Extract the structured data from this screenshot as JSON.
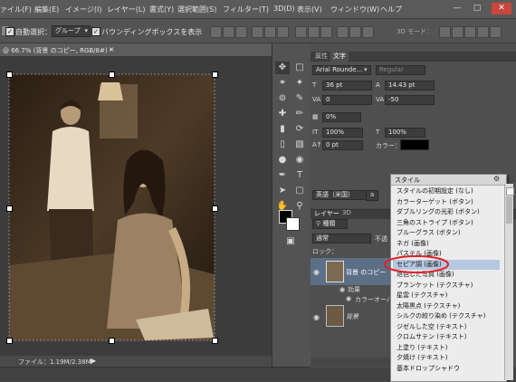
{
  "menu": [
    "ァイル(F)",
    "編集(E)",
    "イメージ(I)",
    "レイヤー(L)",
    "書式(Y)",
    "選択範囲(S)",
    "フィルター(T)",
    "3D(D)",
    "表示(V)",
    "ウィンドウ(W)",
    "ヘルプ"
  ],
  "options": {
    "auto_select_label": "自動選択：",
    "auto_select_value": "グループ",
    "bbox_label": "バウンディングボックスを表示",
    "mode_3d": "3D モード："
  },
  "document": {
    "tab_label": "@ 66.7% (背景 のコピー, RGB/8#) *",
    "file_status": "ファイル：1.19M/2.38M"
  },
  "character": {
    "tabs": [
      "属性",
      "文字"
    ],
    "font_family": "Arial Rounde...",
    "font_style": "Regular",
    "size": "36 pt",
    "leading": "14.43 pt",
    "kerning": "0",
    "tracking": "-50",
    "scale_pct": "0%",
    "vscale": "100%",
    "hscale": "100%",
    "baseline": "0 pt",
    "color_label": "カラー：",
    "language": "英語（米国）",
    "aa_badge": "a"
  },
  "layers": {
    "tabs": [
      "レイヤー",
      "3D"
    ],
    "kind": "種類",
    "blend": "通常",
    "opacity_label": "不透",
    "lock_label": "ロック：",
    "rows": [
      "背景 のコピー",
      "効果",
      "カラーオーバー",
      "背景"
    ]
  },
  "style_panel": {
    "title": "スタイル",
    "items": [
      "スタイルの初期設定 (なし)",
      "カラーターゲット (ボタン)",
      "ダブルリングの光彩 (ボタン)",
      "三角のストライプ (ボタン)",
      "ブルーグラス (ボタン)",
      "ネガ (画像)",
      "パステル (画像)",
      "セピア調 (画像)",
      "退色した写真 (画像)",
      "ブランケット (テクスチャ)",
      "星雲 (テクスチャ)",
      "太陽黒点 (テクスチャ)",
      "シルクの絞り染め (テクスチャ)",
      "ジゼルした空 (テキスト)",
      "クロムサテン (テキスト)",
      "上塗り (テキスト)",
      "夕焼け (テキスト)",
      "基本ドロップシャドウ"
    ],
    "selected_index": 7,
    "highlight_color": "#e0202a"
  }
}
